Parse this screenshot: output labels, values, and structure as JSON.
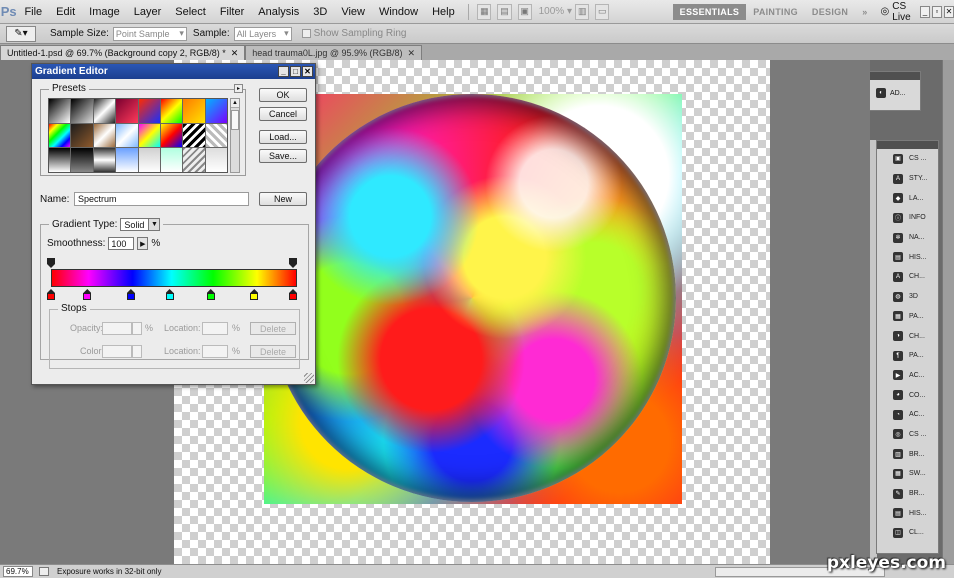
{
  "app": {
    "logo": "Ps"
  },
  "menu": [
    "File",
    "Edit",
    "Image",
    "Layer",
    "Select",
    "Filter",
    "Analysis",
    "3D",
    "View",
    "Window",
    "Help"
  ],
  "menubar": {
    "zoom": "100%",
    "workspaces": [
      "ESSENTIALS",
      "PAINTING",
      "DESIGN"
    ],
    "more": "»",
    "cs_live": "CS Live"
  },
  "options": {
    "sample_size_label": "Sample Size:",
    "sample_size_value": "Point Sample",
    "sample_label": "Sample:",
    "sample_value": "All Layers",
    "show_ring_label": "Show Sampling Ring"
  },
  "tabs": [
    {
      "label": "Untitled-1.psd @ 69.7% (Background copy 2, RGB/8) *",
      "active": true
    },
    {
      "label": "head trauma0L.jpg @ 95.9% (RGB/8)",
      "active": false
    }
  ],
  "dialog": {
    "title": "Gradient Editor",
    "presets_label": "Presets",
    "buttons": {
      "ok": "OK",
      "cancel": "Cancel",
      "load": "Load...",
      "save": "Save...",
      "new": "New"
    },
    "name_label": "Name:",
    "name_value": "Spectrum",
    "gradient_type_label": "Gradient Type:",
    "gradient_type_value": "Solid",
    "smoothness_label": "Smoothness:",
    "smoothness_value": "100",
    "percent": "%",
    "stops_label": "Stops",
    "opacity_label": "Opacity:",
    "color_label": "Color:",
    "location_label": "Location:",
    "delete_label": "Delete",
    "color_stops": [
      {
        "pos": 0,
        "color": "#ff0000"
      },
      {
        "pos": 0.15,
        "color": "#ff00ff"
      },
      {
        "pos": 0.33,
        "color": "#0000ff"
      },
      {
        "pos": 0.49,
        "color": "#00ffff"
      },
      {
        "pos": 0.66,
        "color": "#00ff00"
      },
      {
        "pos": 0.84,
        "color": "#ffff00"
      },
      {
        "pos": 1,
        "color": "#ff0000"
      }
    ]
  },
  "adjustments": {
    "label": "AD..."
  },
  "panels": [
    "CS ...",
    "STY...",
    "LA...",
    "INFO",
    "NA...",
    "HIS...",
    "CH...",
    "3D",
    "PA...",
    "CH...",
    "PA...",
    "AC...",
    "CO...",
    "AC...",
    "CS ...",
    "BR...",
    "SW...",
    "BR...",
    "HIS...",
    "CL..."
  ],
  "status": {
    "zoom": "69.7%",
    "message": "Exposure works in 32-bit only"
  },
  "watermark": "pxleyes.com"
}
